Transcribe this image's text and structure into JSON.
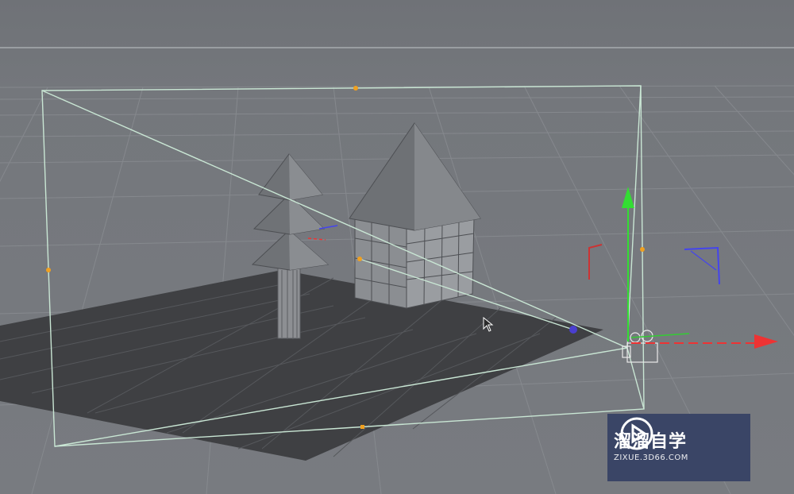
{
  "viewport": {
    "scene_objects": [
      "floor-grid",
      "plane",
      "tree",
      "house",
      "camera"
    ],
    "colors": {
      "background": "#75787d",
      "plane": "#3f4043",
      "grid_lines": "#8d9095",
      "frustum": "#c9e6d4",
      "axis_y": "#33dd33",
      "axis_x": "#ee3333",
      "axis_z": "#4444ee",
      "handle": "#f0a020"
    }
  },
  "watermark": {
    "title": "溜溜自学",
    "subtitle": "ZIXUE.3D66.COM",
    "background": "#3a4566"
  },
  "icons": {
    "cursor": "mouse-pointer-icon",
    "logo": "play-logo-icon"
  }
}
